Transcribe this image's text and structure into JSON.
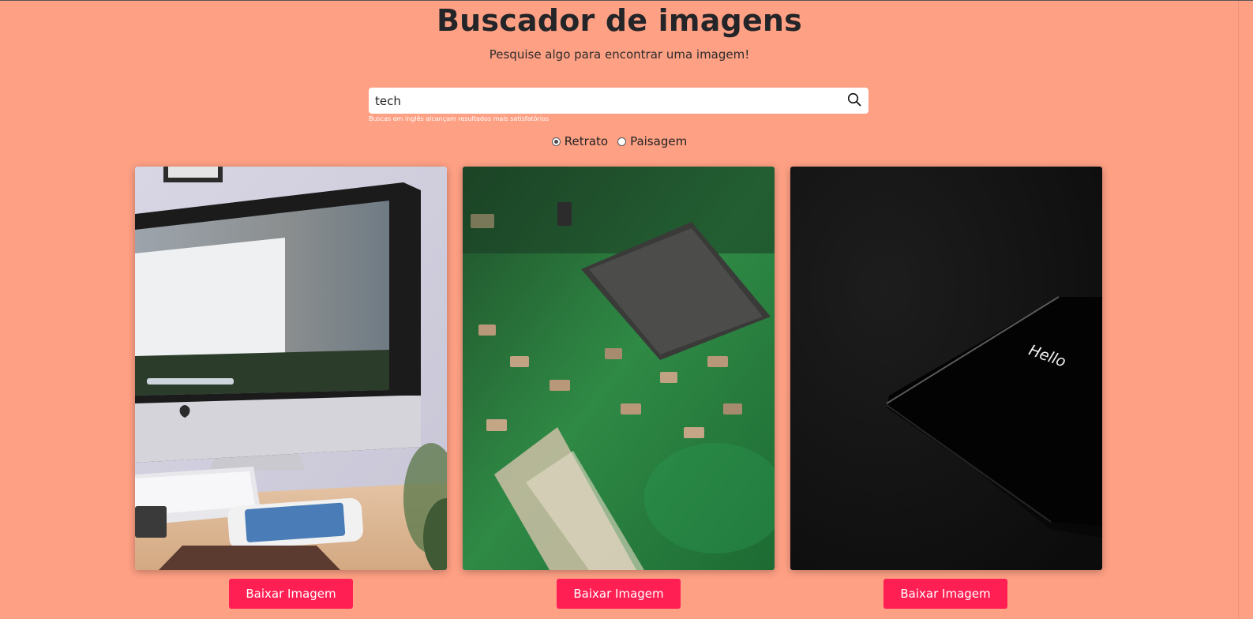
{
  "header": {
    "title": "Buscador de imagens",
    "subtitle": "Pesquise algo para encontrar uma imagem!"
  },
  "search": {
    "value": "tech",
    "hint": "Buscas em inglês alcançam resultados mais satisfatórios",
    "button_icon": "search-icon"
  },
  "orientation": {
    "selected": "Retrato",
    "options": [
      "Retrato",
      "Paisagem"
    ]
  },
  "results": [
    {
      "description": "iMac on desk with keyboard and smartphone",
      "button_label": "Baixar Imagem"
    },
    {
      "description": "Green circuit board close-up with chip",
      "button_label": "Baixar Imagem"
    },
    {
      "description": "Black smartphone on dark surface",
      "screen_text": "Hello",
      "button_label": "Baixar Imagem"
    }
  ],
  "colors": {
    "background": "#fea084",
    "button": "#ff1f52",
    "title": "#232528"
  }
}
